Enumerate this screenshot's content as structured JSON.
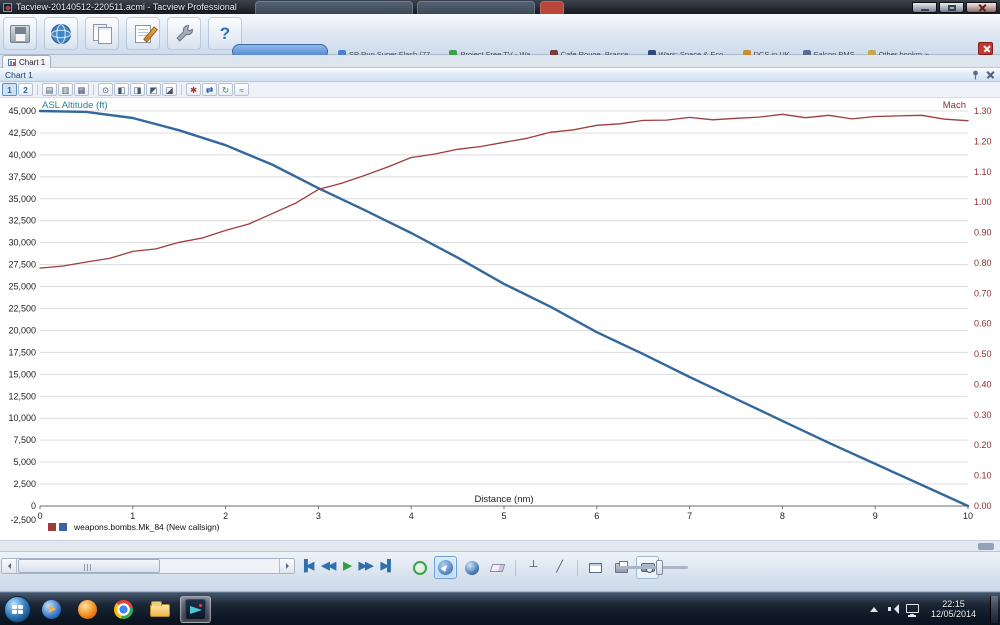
{
  "titlebar": {
    "title": "Tacview-20140512-220511.acmi - Tacview Professional"
  },
  "toolbar": {
    "buttons": [
      {
        "name": "save-button",
        "icon": "disk-icon"
      },
      {
        "name": "globe-button",
        "icon": "globe-icon"
      },
      {
        "name": "documents-button",
        "icon": "documents-icon"
      },
      {
        "name": "edit-button",
        "icon": "notepad-pencil-icon"
      },
      {
        "name": "tools-button",
        "icon": "wrench-icon"
      },
      {
        "name": "help-button",
        "icon": "question-icon",
        "glyph": "?"
      }
    ]
  },
  "browser": {
    "bookmarks": [
      {
        "label": "SP Run Super Flash (77...",
        "color": "#4a7fd4"
      },
      {
        "label": "Project Free TV - Wa...",
        "color": "#3f9e4f"
      },
      {
        "label": "Cafe Rouge, Brasse...",
        "color": "#7a3a3a"
      },
      {
        "label": "Wars: Space & Eco...",
        "color": "#2f4a7a"
      },
      {
        "label": "DCS in UK",
        "color": "#d08a2e"
      },
      {
        "label": "Falcon BMS",
        "color": "#5a6a8a"
      },
      {
        "label": "Other bookm",
        "color": "#c8a84a",
        "chevron": "»"
      }
    ]
  },
  "tabs": {
    "chart_tab": "Chart 1"
  },
  "panel": {
    "title": "Chart 1",
    "toolbar_buttons": [
      {
        "name": "axes-preset-1-button",
        "glyph": "1",
        "color": "blue",
        "on": true
      },
      {
        "name": "axes-preset-2-button",
        "glyph": "2",
        "color": "blue"
      },
      {
        "sep": true
      },
      {
        "name": "chart-style-lines-button",
        "glyph": "▤"
      },
      {
        "name": "chart-style-bars-button",
        "glyph": "▥"
      },
      {
        "name": "chart-style-grid-button",
        "glyph": "▦"
      },
      {
        "sep": true
      },
      {
        "name": "zoom-button",
        "glyph": "⊙"
      },
      {
        "name": "scale-left-axis-button",
        "glyph": "◧"
      },
      {
        "name": "scale-right-axis-button",
        "glyph": "◨"
      },
      {
        "name": "scale-up-button",
        "glyph": "◩"
      },
      {
        "name": "scale-down-button",
        "glyph": "◪"
      },
      {
        "sep": true
      },
      {
        "name": "clear-chart-button",
        "glyph": "✱",
        "color": "red"
      },
      {
        "name": "swap-axes-button",
        "glyph": "⇄",
        "color": "blue"
      },
      {
        "name": "refresh-chart-button",
        "glyph": "↻",
        "color": "green"
      },
      {
        "name": "auto-scale-button",
        "glyph": "≈",
        "color": "green"
      }
    ]
  },
  "icons": {
    "telemetry_glyph": "┴",
    "ruler_glyph": "╱"
  },
  "chart_data": {
    "type": "line",
    "title": "",
    "xlabel": "Distance (nm)",
    "xlim": [
      0,
      10
    ],
    "grid": "horizontal",
    "legend_position": "bottom-left",
    "legend_label": "weapons.bombs.Mk_84 (New callsign)",
    "legend_colors": [
      "#9e3d3d",
      "#34689c"
    ],
    "x_ticks": [
      {
        "v": 0,
        "label": "0"
      },
      {
        "v": 1,
        "label": "1"
      },
      {
        "v": 2,
        "label": "2"
      },
      {
        "v": 3,
        "label": "3"
      },
      {
        "v": 4,
        "label": "4"
      },
      {
        "v": 5,
        "label": "5"
      },
      {
        "v": 6,
        "label": "6"
      },
      {
        "v": 7,
        "label": "7"
      },
      {
        "v": 8,
        "label": "8"
      },
      {
        "v": 9,
        "label": "9"
      },
      {
        "v": 10,
        "label": "10"
      }
    ],
    "left_axis": {
      "label": "ASL Altitude (ft)",
      "color": "#2e7f93",
      "min": 0,
      "max": 45000,
      "ticks": [
        {
          "v": 45000,
          "label": "45,000"
        },
        {
          "v": 42500,
          "label": "42,500"
        },
        {
          "v": 40000,
          "label": "40,000"
        },
        {
          "v": 37500,
          "label": "37,500"
        },
        {
          "v": 35000,
          "label": "35,000"
        },
        {
          "v": 32500,
          "label": "32,500"
        },
        {
          "v": 30000,
          "label": "30,000"
        },
        {
          "v": 27500,
          "label": "27,500"
        },
        {
          "v": 25000,
          "label": "25,000"
        },
        {
          "v": 22500,
          "label": "22,500"
        },
        {
          "v": 20000,
          "label": "20,000"
        },
        {
          "v": 17500,
          "label": "17,500"
        },
        {
          "v": 15000,
          "label": "15,000"
        },
        {
          "v": 12500,
          "label": "12,500"
        },
        {
          "v": 10000,
          "label": "10,000"
        },
        {
          "v": 7500,
          "label": "7,500"
        },
        {
          "v": 5000,
          "label": "5,000"
        },
        {
          "v": 2500,
          "label": "2,500"
        },
        {
          "v": 0,
          "label": "0"
        },
        {
          "v": -2500,
          "label": "-2,500"
        }
      ]
    },
    "right_axis": {
      "label": "Mach",
      "color": "#8b2e2e",
      "min": 0,
      "max": 1.3,
      "ticks": [
        {
          "v": 1.3,
          "label": "1.30"
        },
        {
          "v": 1.2,
          "label": "1.20"
        },
        {
          "v": 1.1,
          "label": "1.10"
        },
        {
          "v": 1.0,
          "label": "1.00"
        },
        {
          "v": 0.9,
          "label": "0.90"
        },
        {
          "v": 0.8,
          "label": "0.80"
        },
        {
          "v": 0.7,
          "label": "0.70"
        },
        {
          "v": 0.6,
          "label": "0.60"
        },
        {
          "v": 0.5,
          "label": "0.50"
        },
        {
          "v": 0.4,
          "label": "0.40"
        },
        {
          "v": 0.3,
          "label": "0.30"
        },
        {
          "v": 0.2,
          "label": "0.20"
        },
        {
          "v": 0.1,
          "label": "0.10"
        },
        {
          "v": 0.0,
          "label": "0.00"
        }
      ]
    },
    "series": [
      {
        "name": "ASL Altitude (ft)",
        "axis": "left",
        "color": "#34689c",
        "width": 2.4,
        "x": [
          0,
          0.5,
          1,
          1.5,
          2,
          2.5,
          3,
          3.5,
          4,
          4.5,
          5,
          5.5,
          6,
          6.5,
          7,
          7.5,
          8,
          8.5,
          9,
          9.5,
          10
        ],
        "y": [
          45000,
          44900,
          44200,
          42800,
          41100,
          38900,
          36200,
          33700,
          31100,
          28300,
          25300,
          22700,
          19800,
          17300,
          14700,
          12200,
          9700,
          7200,
          4800,
          2400,
          0
        ]
      },
      {
        "name": "Mach",
        "axis": "right",
        "color": "#9e3d3d",
        "width": 1.3,
        "x": [
          0,
          0.25,
          0.5,
          0.75,
          1,
          1.25,
          1.5,
          1.75,
          2,
          2.25,
          2.5,
          2.75,
          3,
          3.25,
          3.5,
          3.75,
          4,
          4.25,
          4.5,
          4.75,
          5,
          5.25,
          5.5,
          5.75,
          6,
          6.25,
          6.5,
          6.75,
          7,
          7.25,
          7.5,
          7.75,
          8,
          8.25,
          8.5,
          8.75,
          9,
          9.25,
          9.5,
          9.75,
          10
        ],
        "y": [
          0.783,
          0.79,
          0.803,
          0.815,
          0.838,
          0.846,
          0.868,
          0.882,
          0.907,
          0.928,
          0.962,
          0.996,
          1.042,
          1.062,
          1.088,
          1.116,
          1.147,
          1.158,
          1.174,
          1.183,
          1.197,
          1.21,
          1.23,
          1.238,
          1.253,
          1.258,
          1.269,
          1.27,
          1.279,
          1.271,
          1.276,
          1.28,
          1.289,
          1.278,
          1.286,
          1.274,
          1.282,
          1.284,
          1.286,
          1.273,
          1.268
        ]
      }
    ]
  },
  "controlbar": {
    "playback": [
      {
        "name": "skip-to-start-button",
        "glyph": "▐◀",
        "color": "#2e6fae"
      },
      {
        "name": "rewind-button",
        "glyph": "◀◀",
        "color": "#2e6fae"
      },
      {
        "name": "play-button",
        "glyph": "▶",
        "color": "#2f9e3f"
      },
      {
        "name": "fast-forward-button",
        "glyph": "▶▶",
        "color": "#2e6fae"
      },
      {
        "name": "skip-to-end-button",
        "glyph": "▶▌",
        "color": "#2e6fae"
      }
    ],
    "view_buttons": [
      "map-view",
      "world-view",
      "globe-view",
      "eraser",
      "telemetry",
      "measure",
      "layout",
      "printer",
      "screenshot"
    ]
  },
  "taskbar": {
    "time": "22:15",
    "date": "12/05/2014",
    "apps": [
      "media-player",
      "firefox",
      "chrome",
      "explorer",
      "tacview"
    ]
  }
}
